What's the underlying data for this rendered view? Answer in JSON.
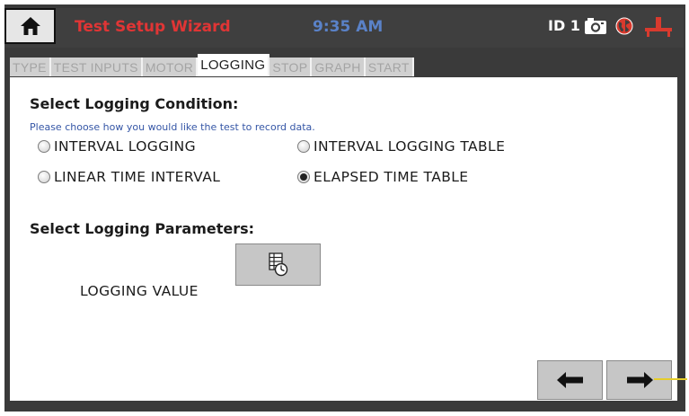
{
  "header": {
    "title": "Test Setup Wizard",
    "time": "9:35 AM",
    "id_label": "ID 1",
    "icons": [
      "home-icon",
      "camera-icon",
      "globe-icon",
      "plug-icon"
    ]
  },
  "tabs": [
    {
      "label": "TYPE",
      "active": false
    },
    {
      "label": "TEST INPUTS",
      "active": false
    },
    {
      "label": "MOTOR",
      "active": false
    },
    {
      "label": "LOGGING",
      "active": true
    },
    {
      "label": "STOP",
      "active": false
    },
    {
      "label": "GRAPH",
      "active": false
    },
    {
      "label": "START",
      "active": false
    }
  ],
  "logging_condition": {
    "heading": "Select Logging Condition:",
    "hint": "Please choose how you would like the test to record data.",
    "options": [
      {
        "label": "INTERVAL LOGGING",
        "selected": false
      },
      {
        "label": "INTERVAL LOGGING TABLE",
        "selected": false
      },
      {
        "label": "LINEAR TIME INTERVAL",
        "selected": false
      },
      {
        "label": "ELAPSED TIME TABLE",
        "selected": true
      }
    ]
  },
  "logging_parameters": {
    "heading": "Select Logging Parameters:",
    "value_label": "LOGGING VALUE",
    "value_button_icon": "table-clock-icon"
  },
  "navigation": {
    "back_icon": "arrow-left-icon",
    "next_icon": "arrow-right-icon"
  },
  "colors": {
    "header_bg": "#3f3f3f",
    "title": "#e03535",
    "time": "#5a82c8",
    "hint": "#3556a6",
    "indicator": "#e5cd2a"
  }
}
